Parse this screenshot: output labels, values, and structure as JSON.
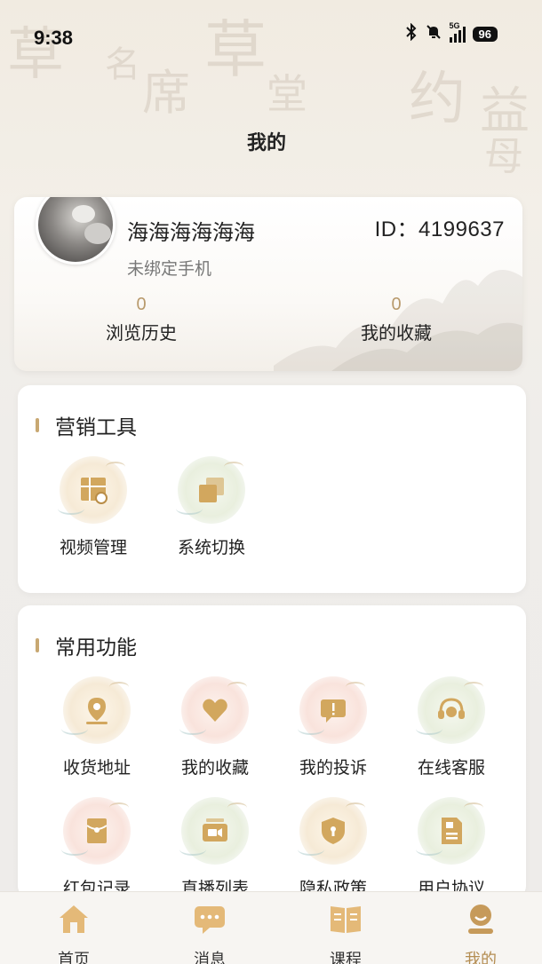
{
  "status_bar": {
    "time": "9:38",
    "network": "5G",
    "battery": "96",
    "icons": [
      "bluetooth-icon",
      "mute-icon",
      "signal-icon",
      "battery-icon"
    ]
  },
  "header": {
    "title": "我的"
  },
  "profile": {
    "name": "海海海海海海",
    "id_text": "ID：4199637",
    "phone_status": "未绑定手机",
    "stats": [
      {
        "value": "0",
        "label": "浏览历史"
      },
      {
        "value": "0",
        "label": "我的收藏"
      }
    ]
  },
  "marketing": {
    "title": "营销工具",
    "items": [
      {
        "label": "视频管理",
        "icon": "video-manage-icon"
      },
      {
        "label": "系统切换",
        "icon": "system-switch-icon"
      }
    ]
  },
  "common": {
    "title": "常用功能",
    "items": [
      {
        "label": "收货地址",
        "icon": "location-icon"
      },
      {
        "label": "我的收藏",
        "icon": "heart-icon"
      },
      {
        "label": "我的投诉",
        "icon": "complaint-icon"
      },
      {
        "label": "在线客服",
        "icon": "customer-service-icon"
      },
      {
        "label": "红包记录",
        "icon": "red-envelope-icon"
      },
      {
        "label": "直播列表",
        "icon": "live-camera-icon"
      },
      {
        "label": "隐私政策",
        "icon": "shield-lock-icon"
      },
      {
        "label": "用户协议",
        "icon": "agreement-icon"
      }
    ]
  },
  "bottom_nav": {
    "items": [
      {
        "label": "首页",
        "icon": "home-icon"
      },
      {
        "label": "消息",
        "icon": "message-icon"
      },
      {
        "label": "课程",
        "icon": "book-icon"
      },
      {
        "label": "我的",
        "icon": "profile-icon"
      }
    ],
    "active": "我的"
  },
  "colors": {
    "accent": "#c8a872",
    "icon_gold": "#d2a75e",
    "active_nav": "#b48d52",
    "stat_value": "#b89a6c"
  }
}
